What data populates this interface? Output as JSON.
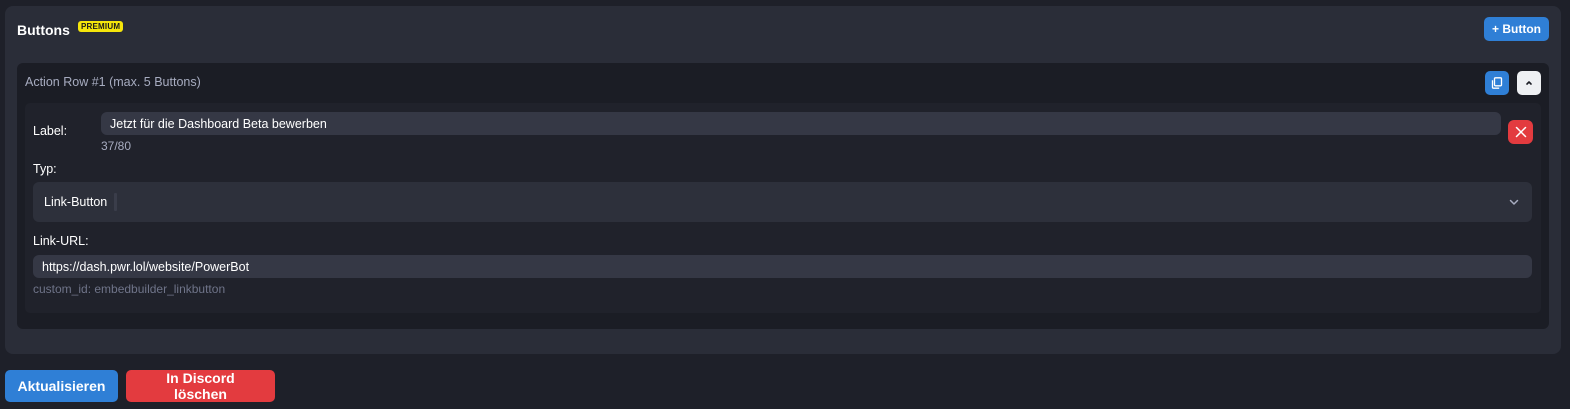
{
  "buttons_panel": {
    "title": "Buttons",
    "premium_badge": "PREMIUM",
    "add_button_label": "+ Button"
  },
  "action_row": {
    "title": "Action Row #1 (max. 5 Buttons)",
    "label_caption": "Label:",
    "label_value": "Jetzt für die Dashboard Beta bewerben",
    "label_counter": "37/80",
    "type_caption": "Typ:",
    "type_value": "Link-Button",
    "url_caption": "Link-URL:",
    "url_value": "https://dash.pwr.lol/website/PowerBot",
    "custom_id": "custom_id: embedbuilder_linkbutton"
  },
  "footer": {
    "update_label": "Aktualisieren",
    "delete_label": "In Discord löschen"
  },
  "colors": {
    "accent_blue": "#2f7fd6",
    "danger_red": "#e33b3f",
    "premium_yellow": "#f5e50b"
  }
}
